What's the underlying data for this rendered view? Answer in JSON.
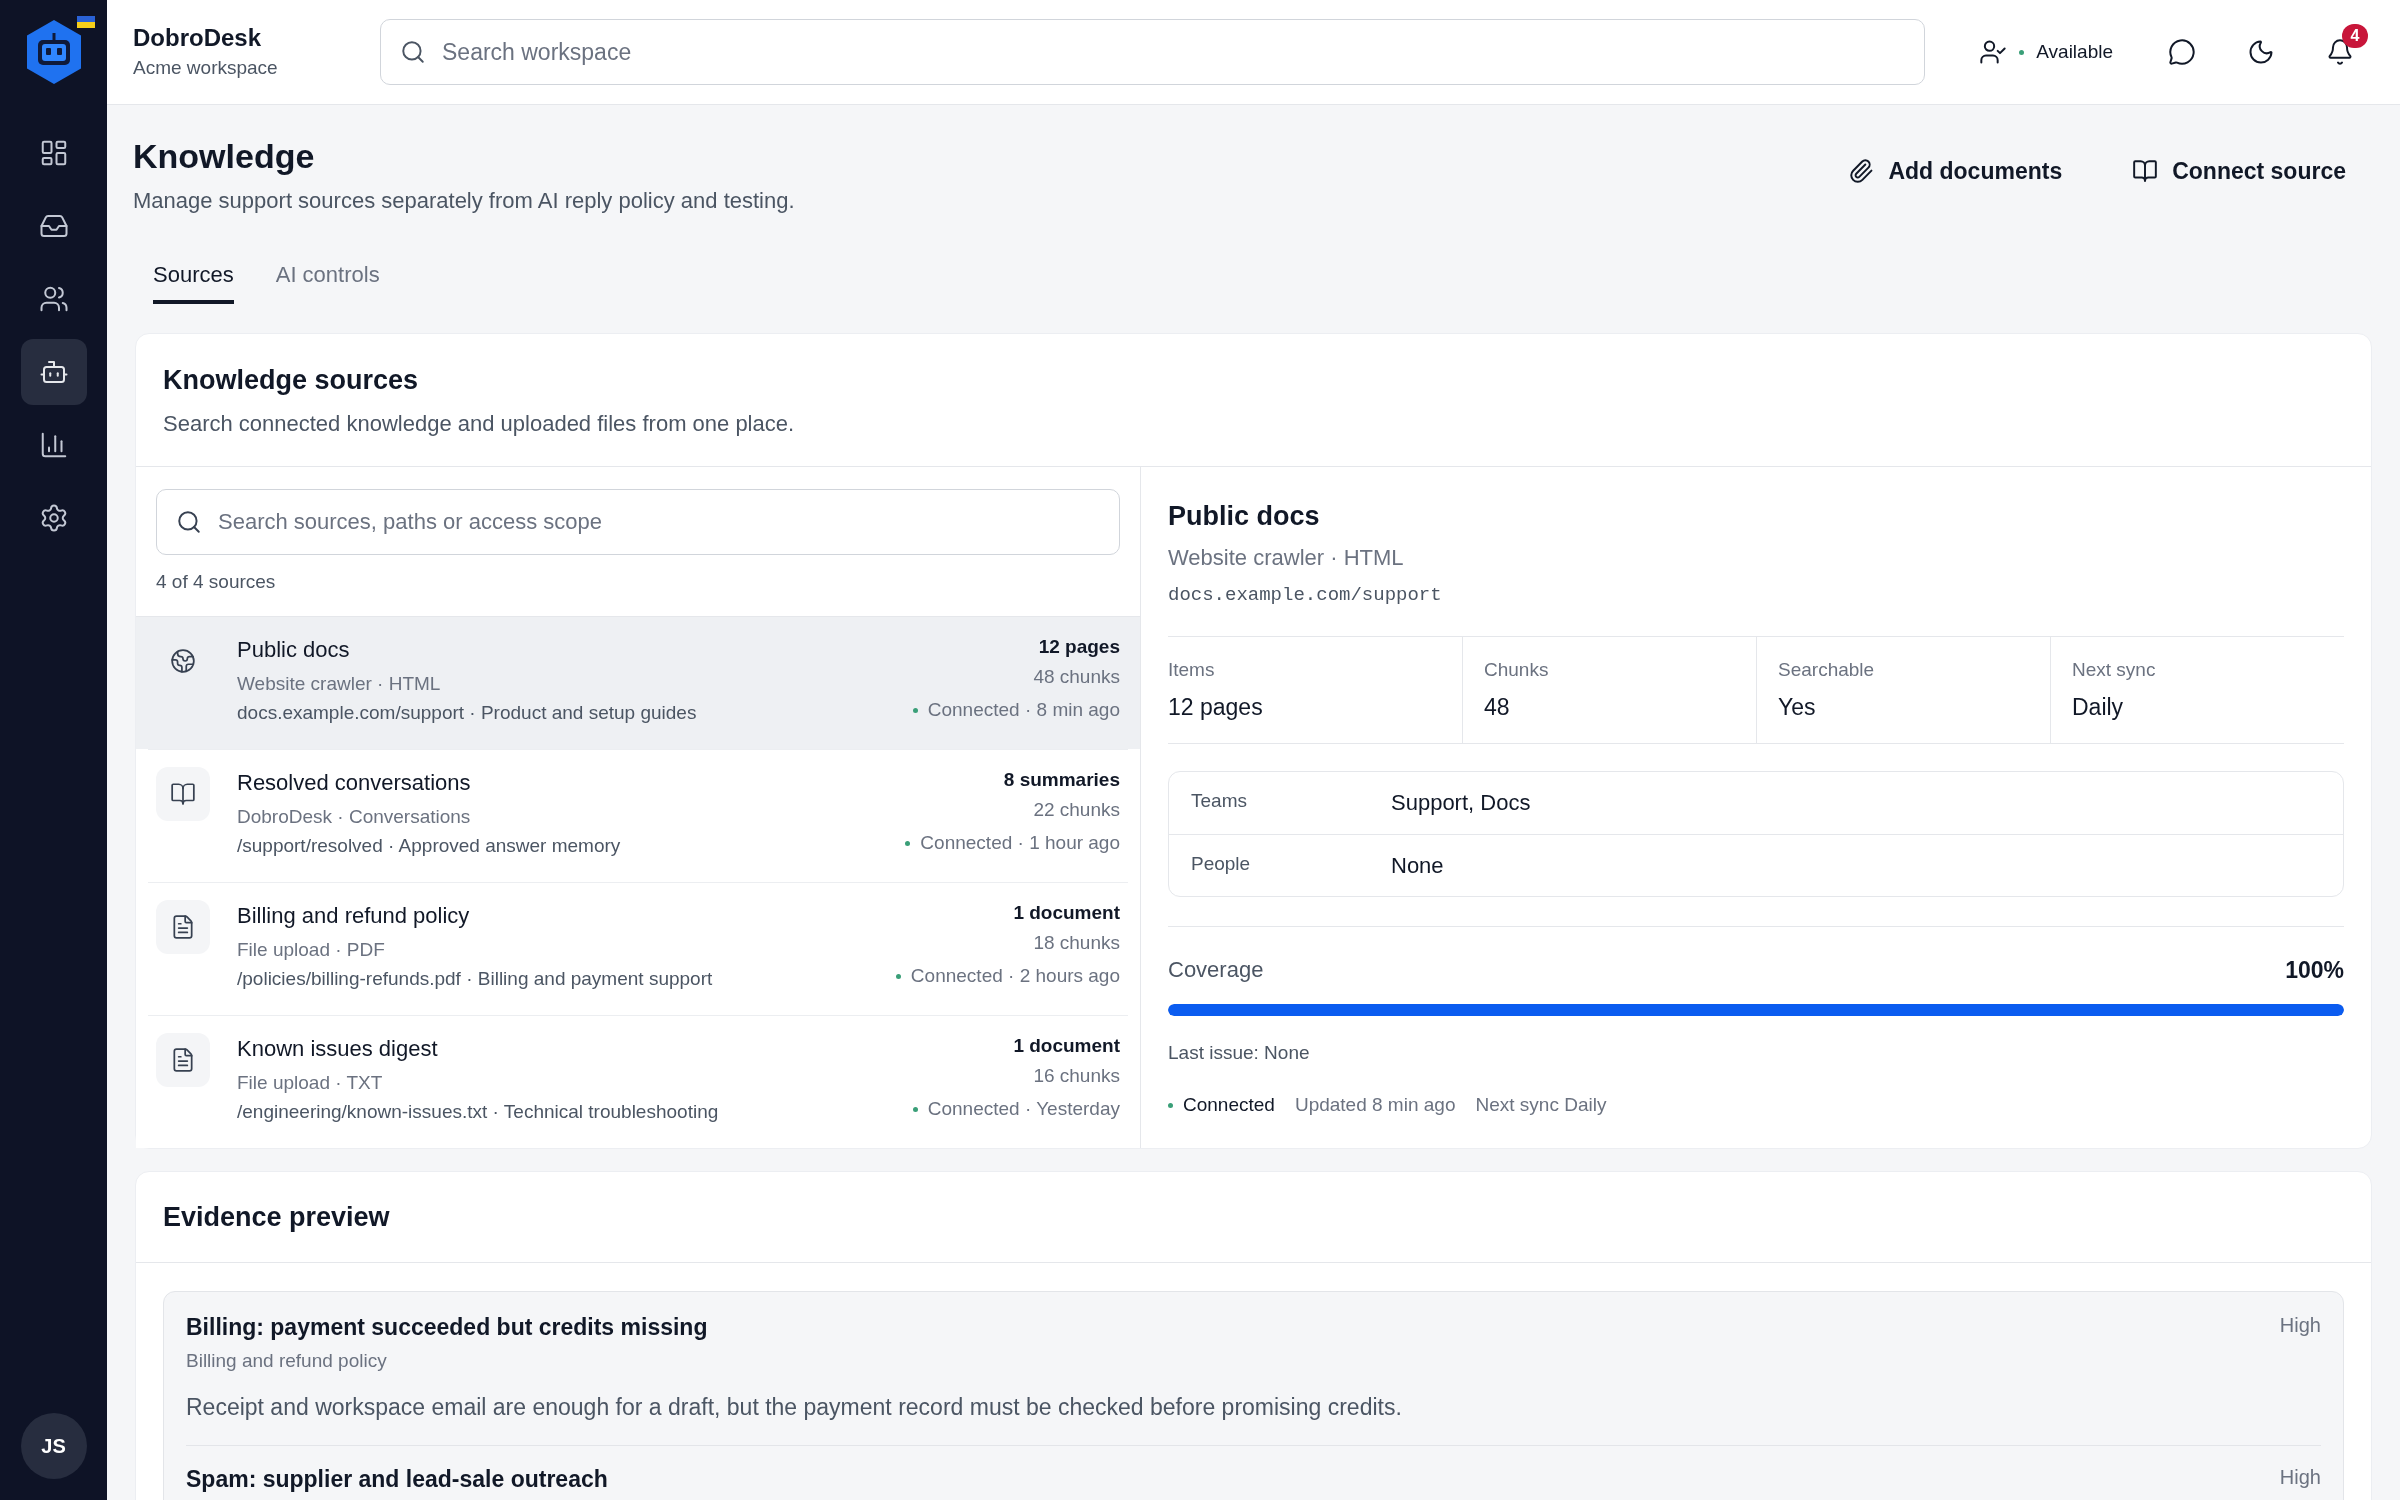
{
  "app": {
    "name": "DobroDesk",
    "workspace": "Acme workspace",
    "avatar": "JS"
  },
  "sidebar": {
    "items": [
      {
        "kind": "grid",
        "selected": false
      },
      {
        "kind": "inbox",
        "selected": false
      },
      {
        "kind": "people",
        "selected": false
      },
      {
        "kind": "robot",
        "selected": true
      },
      {
        "kind": "chart",
        "selected": false
      },
      {
        "kind": "gear",
        "selected": false
      }
    ]
  },
  "header": {
    "search": {
      "placeholder": "Search workspace"
    },
    "status": "Available",
    "notifications": "4"
  },
  "page": {
    "title": "Knowledge",
    "subtitle": "Manage support sources separately from AI reply policy and testing.",
    "actions": [
      {
        "kind": "paperclip",
        "label": "Add documents"
      },
      {
        "kind": "book",
        "label": "Connect source"
      }
    ]
  },
  "tabs": [
    {
      "label": "Sources",
      "selected": true
    },
    {
      "label": "AI controls",
      "selected": false
    }
  ],
  "sources": {
    "title": "Knowledge sources",
    "subtitle": "Search connected knowledge and uploaded files from one place.",
    "search": {
      "placeholder": "Search sources, paths or access scope"
    },
    "count": "4 of 4 sources",
    "items": [
      {
        "kind": "globe",
        "selected": true,
        "name": "Public docs",
        "type": "Website crawler · HTML",
        "path": "docs.example.com/support · Product and setup guides",
        "size": "12 pages",
        "chunks": "48 chunks",
        "status": "Connected · 8 min ago"
      },
      {
        "kind": "book",
        "selected": false,
        "name": "Resolved conversations",
        "type": "DobroDesk · Conversations",
        "path": "/support/resolved · Approved answer memory",
        "size": "8 summaries",
        "chunks": "22 chunks",
        "status": "Connected · 1 hour ago"
      },
      {
        "kind": "file",
        "selected": false,
        "name": "Billing and refund policy",
        "type": "File upload · PDF",
        "path": "/policies/billing-refunds.pdf · Billing and payment support",
        "size": "1 document",
        "chunks": "18 chunks",
        "status": "Connected · 2 hours ago"
      },
      {
        "kind": "file",
        "selected": false,
        "name": "Known issues digest",
        "type": "File upload · TXT",
        "path": "/engineering/known-issues.txt · Technical troubleshooting",
        "size": "1 document",
        "chunks": "16 chunks",
        "status": "Connected · Yesterday"
      }
    ]
  },
  "detail": {
    "title": "Public docs",
    "type": "Website crawler · HTML",
    "url": "docs.example.com/support",
    "stats": [
      {
        "label": "Items",
        "value": "12 pages"
      },
      {
        "label": "Chunks",
        "value": "48"
      },
      {
        "label": "Searchable",
        "value": "Yes"
      },
      {
        "label": "Next sync",
        "value": "Daily"
      }
    ],
    "access": [
      {
        "label": "Teams",
        "value": "Support, Docs"
      },
      {
        "label": "People",
        "value": "None"
      }
    ],
    "coverage": {
      "label": "Coverage",
      "reading": "100%",
      "level": 1
    },
    "last_issue": "Last issue: None",
    "footer": {
      "status": "Connected",
      "updated": "Updated 8 min ago",
      "next_sync": "Next sync Daily"
    }
  },
  "evidence": {
    "title": "Evidence preview",
    "items": [
      {
        "title": "Billing: payment succeeded but credits missing",
        "source": "Billing and refund policy",
        "text": "Receipt and workspace email are enough for a draft, but the payment record must be checked before promising credits.",
        "priority": "High"
      },
      {
        "title": "Spam: supplier and lead-sale outreach",
        "priority": "High"
      }
    ]
  }
}
